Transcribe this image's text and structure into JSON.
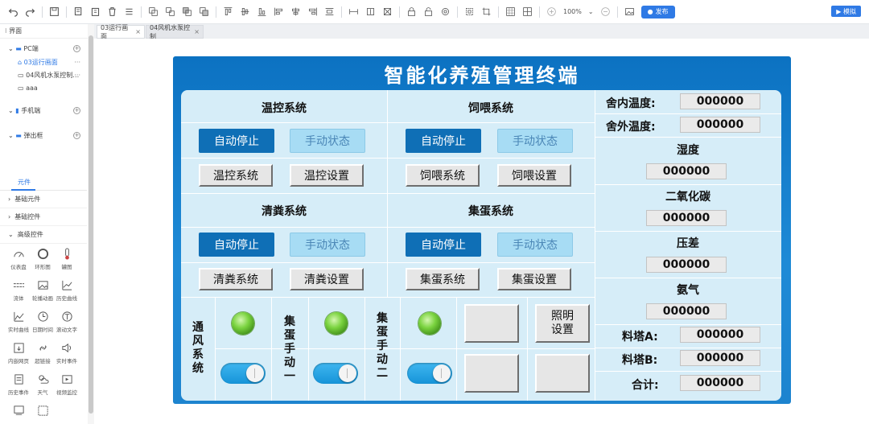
{
  "toolbar": {
    "zoom": "100%",
    "publish": "发布",
    "simulate": "模拟"
  },
  "sidebar": {
    "title": "界面",
    "groups": [
      {
        "label": "PC端",
        "items": [
          "03运行画面",
          "04风机水泵控制…",
          "aaa"
        ]
      },
      {
        "label": "手机端",
        "items": []
      },
      {
        "label": "弹出框",
        "items": []
      }
    ],
    "tab": "元件",
    "categories": [
      "基础元件",
      "基础控件",
      "高级控件"
    ],
    "components": [
      "仪表盘",
      "环形图",
      "罐图",
      "流体",
      "轮播动画",
      "历史曲线",
      "实时曲线",
      "日期时间",
      "滚动文字",
      "内嵌网页",
      "超链接",
      "实时事件",
      "历史事件",
      "天气",
      "视频监控"
    ]
  },
  "doc_tabs": [
    {
      "label": "03运行画面"
    },
    {
      "label": "04风机水泵控制"
    }
  ],
  "hmi": {
    "title": "智能化养殖管理终端",
    "systems": [
      {
        "title": "温控系统",
        "auto": "自动停止",
        "manual": "手动状态",
        "btn1": "温控系统",
        "btn2": "温控设置"
      },
      {
        "title": "饲喂系统",
        "auto": "自动停止",
        "manual": "手动状态",
        "btn1": "饲喂系统",
        "btn2": "饲喂设置"
      },
      {
        "title": "清粪系统",
        "auto": "自动停止",
        "manual": "手动状态",
        "btn1": "清粪系统",
        "btn2": "清粪设置"
      },
      {
        "title": "集蛋系统",
        "auto": "自动停止",
        "manual": "手动状态",
        "btn1": "集蛋系统",
        "btn2": "集蛋设置"
      }
    ],
    "switches": [
      {
        "label": "通风系统",
        "on": true
      },
      {
        "label": "集蛋手动一",
        "on": true
      },
      {
        "label": "集蛋手动二",
        "on": true
      }
    ],
    "lighting": "照明设置",
    "readings": {
      "inside_temp_label": "舍内温度:",
      "inside_temp": "000000",
      "outside_temp_label": "舍外温度:",
      "outside_temp": "000000",
      "humidity_label": "湿度",
      "humidity": "000000",
      "co2_label": "二氧化碳",
      "co2": "000000",
      "pressure_label": "压差",
      "pressure": "000000",
      "ammonia_label": "氨气",
      "ammonia": "000000",
      "tower_a_label": "料塔A:",
      "tower_a": "000000",
      "tower_b_label": "料塔B:",
      "tower_b": "000000",
      "total_label": "合计:",
      "total": "000000"
    }
  }
}
